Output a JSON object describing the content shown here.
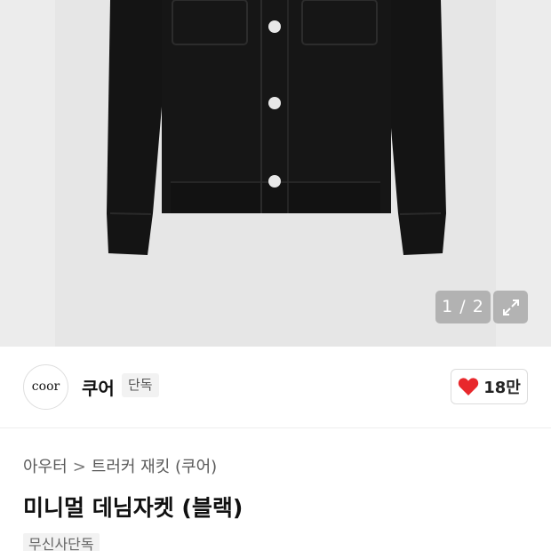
{
  "gallery": {
    "counter": "1 / 2",
    "current_index": 1,
    "total": 2,
    "expand_icon": "expand-icon"
  },
  "brand": {
    "logo_text": "coor",
    "name": "쿠어",
    "tag": "단독"
  },
  "like": {
    "icon": "heart-icon",
    "count": "18만",
    "color": "#e8282c"
  },
  "breadcrumb": {
    "items": [
      "아우터",
      "트러커 재킷 (쿠어)"
    ],
    "separator": ">"
  },
  "product": {
    "title": "미니멀 데님자켓 (블랙)",
    "badge": "무신사단독"
  }
}
